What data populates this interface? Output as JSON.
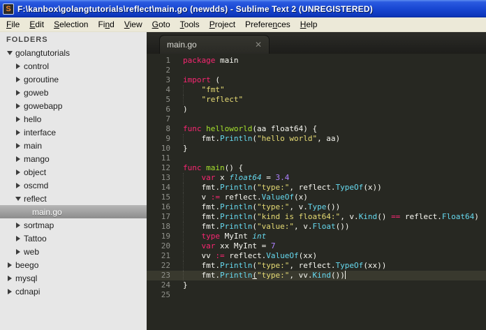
{
  "window": {
    "title": "F:\\kanbox\\golangtutorials\\reflect\\main.go (newdds) - Sublime Text 2 (UNREGISTERED)",
    "icon_letter": "S"
  },
  "menubar": {
    "items": [
      {
        "label": "File",
        "mnemonic_index": 0
      },
      {
        "label": "Edit",
        "mnemonic_index": 0
      },
      {
        "label": "Selection",
        "mnemonic_index": 0
      },
      {
        "label": "Find",
        "mnemonic_index": 2
      },
      {
        "label": "View",
        "mnemonic_index": 0
      },
      {
        "label": "Goto",
        "mnemonic_index": 0
      },
      {
        "label": "Tools",
        "mnemonic_index": 0
      },
      {
        "label": "Project",
        "mnemonic_index": 0
      },
      {
        "label": "Preferences",
        "mnemonic_index": 7
      },
      {
        "label": "Help",
        "mnemonic_index": 0
      }
    ]
  },
  "sidebar": {
    "header": "FOLDERS",
    "items": [
      {
        "label": "golangtutorials",
        "level": 0,
        "kind": "folder",
        "state": "expanded",
        "selected": false
      },
      {
        "label": "control",
        "level": 1,
        "kind": "folder",
        "state": "collapsed",
        "selected": false
      },
      {
        "label": "goroutine",
        "level": 1,
        "kind": "folder",
        "state": "collapsed",
        "selected": false
      },
      {
        "label": "goweb",
        "level": 1,
        "kind": "folder",
        "state": "collapsed",
        "selected": false
      },
      {
        "label": "gowebapp",
        "level": 1,
        "kind": "folder",
        "state": "collapsed",
        "selected": false
      },
      {
        "label": "hello",
        "level": 1,
        "kind": "folder",
        "state": "collapsed",
        "selected": false
      },
      {
        "label": "interface",
        "level": 1,
        "kind": "folder",
        "state": "collapsed",
        "selected": false
      },
      {
        "label": "main",
        "level": 1,
        "kind": "folder",
        "state": "collapsed",
        "selected": false
      },
      {
        "label": "mango",
        "level": 1,
        "kind": "folder",
        "state": "collapsed",
        "selected": false
      },
      {
        "label": "object",
        "level": 1,
        "kind": "folder",
        "state": "collapsed",
        "selected": false
      },
      {
        "label": "oscmd",
        "level": 1,
        "kind": "folder",
        "state": "collapsed",
        "selected": false
      },
      {
        "label": "reflect",
        "level": 1,
        "kind": "folder",
        "state": "expanded",
        "selected": false
      },
      {
        "label": "main.go",
        "level": 2,
        "kind": "file",
        "state": "none",
        "selected": true
      },
      {
        "label": "sortmap",
        "level": 1,
        "kind": "folder",
        "state": "collapsed",
        "selected": false
      },
      {
        "label": "Tattoo",
        "level": 1,
        "kind": "folder",
        "state": "collapsed",
        "selected": false
      },
      {
        "label": "web",
        "level": 1,
        "kind": "folder",
        "state": "collapsed",
        "selected": false
      },
      {
        "label": "beego",
        "level": 0,
        "kind": "folder",
        "state": "collapsed",
        "selected": false
      },
      {
        "label": "mysql",
        "level": 0,
        "kind": "folder",
        "state": "collapsed",
        "selected": false
      },
      {
        "label": "cdnapi",
        "level": 0,
        "kind": "folder",
        "state": "collapsed",
        "selected": false
      }
    ]
  },
  "editor": {
    "tab": {
      "label": "main.go",
      "close_glyph": "✕"
    },
    "language": "go",
    "cursor_line": 23,
    "colors": {
      "background": "#272822",
      "keyword": "#f92672",
      "plain": "#f8f8f2",
      "string": "#e6db74",
      "function_name": "#a6e22e",
      "type_italic": "#66d9ef",
      "builtin_call": "#66d9ef",
      "number": "#ae81ff",
      "gutter": "#8f908a",
      "line_highlight": "#39392e"
    },
    "lines": [
      {
        "n": 1,
        "tokens": [
          [
            "kw",
            "package"
          ],
          [
            "pl",
            " main"
          ]
        ]
      },
      {
        "n": 2,
        "tokens": []
      },
      {
        "n": 3,
        "tokens": [
          [
            "kw",
            "import"
          ],
          [
            "pl",
            " ("
          ]
        ]
      },
      {
        "n": 4,
        "tokens": [
          [
            "pl",
            "    "
          ],
          [
            "str",
            "\"fmt\""
          ]
        ]
      },
      {
        "n": 5,
        "tokens": [
          [
            "pl",
            "    "
          ],
          [
            "str",
            "\"reflect\""
          ]
        ]
      },
      {
        "n": 6,
        "tokens": [
          [
            "pl",
            ")"
          ]
        ]
      },
      {
        "n": 7,
        "tokens": []
      },
      {
        "n": 8,
        "tokens": [
          [
            "kw",
            "func"
          ],
          [
            "pl",
            " "
          ],
          [
            "fn",
            "helloworld"
          ],
          [
            "pl",
            "(aa float64) {"
          ]
        ]
      },
      {
        "n": 9,
        "tokens": [
          [
            "pl",
            "    fmt."
          ],
          [
            "call",
            "Println"
          ],
          [
            "pl",
            "("
          ],
          [
            "str",
            "\"hello world\""
          ],
          [
            "pl",
            ", aa)"
          ]
        ]
      },
      {
        "n": 10,
        "tokens": [
          [
            "pl",
            "}"
          ]
        ]
      },
      {
        "n": 11,
        "tokens": []
      },
      {
        "n": 12,
        "tokens": [
          [
            "kw",
            "func"
          ],
          [
            "pl",
            " "
          ],
          [
            "fn",
            "main"
          ],
          [
            "pl",
            "() {"
          ]
        ]
      },
      {
        "n": 13,
        "tokens": [
          [
            "pl",
            "    "
          ],
          [
            "kw",
            "var"
          ],
          [
            "pl",
            " x "
          ],
          [
            "ty",
            "float64"
          ],
          [
            "pl",
            " = "
          ],
          [
            "num",
            "3.4"
          ]
        ]
      },
      {
        "n": 14,
        "tokens": [
          [
            "pl",
            "    fmt."
          ],
          [
            "call",
            "Println"
          ],
          [
            "pl",
            "("
          ],
          [
            "str",
            "\"type:\""
          ],
          [
            "pl",
            ", reflect."
          ],
          [
            "call",
            "TypeOf"
          ],
          [
            "pl",
            "(x))"
          ]
        ]
      },
      {
        "n": 15,
        "tokens": [
          [
            "pl",
            "    v "
          ],
          [
            "kw",
            ":="
          ],
          [
            "pl",
            " reflect."
          ],
          [
            "call",
            "ValueOf"
          ],
          [
            "pl",
            "(x)"
          ]
        ]
      },
      {
        "n": 16,
        "tokens": [
          [
            "pl",
            "    fmt."
          ],
          [
            "call",
            "Println"
          ],
          [
            "pl",
            "("
          ],
          [
            "str",
            "\"type:\""
          ],
          [
            "pl",
            ", v."
          ],
          [
            "call",
            "Type"
          ],
          [
            "pl",
            "())"
          ]
        ]
      },
      {
        "n": 17,
        "tokens": [
          [
            "pl",
            "    fmt."
          ],
          [
            "call",
            "Println"
          ],
          [
            "pl",
            "("
          ],
          [
            "str",
            "\"kind is float64:\""
          ],
          [
            "pl",
            ", v."
          ],
          [
            "call",
            "Kind"
          ],
          [
            "pl",
            "() "
          ],
          [
            "kw",
            "=="
          ],
          [
            "pl",
            " reflect."
          ],
          [
            "call",
            "Float64"
          ],
          [
            "pl",
            ")"
          ]
        ]
      },
      {
        "n": 18,
        "tokens": [
          [
            "pl",
            "    fmt."
          ],
          [
            "call",
            "Println"
          ],
          [
            "pl",
            "("
          ],
          [
            "str",
            "\"value:\""
          ],
          [
            "pl",
            ", v."
          ],
          [
            "call",
            "Float"
          ],
          [
            "pl",
            "())"
          ]
        ]
      },
      {
        "n": 19,
        "tokens": [
          [
            "pl",
            "    "
          ],
          [
            "kw",
            "type"
          ],
          [
            "pl",
            " MyInt "
          ],
          [
            "ty",
            "int"
          ]
        ]
      },
      {
        "n": 20,
        "tokens": [
          [
            "pl",
            "    "
          ],
          [
            "kw",
            "var"
          ],
          [
            "pl",
            " xx MyInt = "
          ],
          [
            "num",
            "7"
          ]
        ]
      },
      {
        "n": 21,
        "tokens": [
          [
            "pl",
            "    vv "
          ],
          [
            "kw",
            ":="
          ],
          [
            "pl",
            " reflect."
          ],
          [
            "call",
            "ValueOf"
          ],
          [
            "pl",
            "(xx)"
          ]
        ]
      },
      {
        "n": 22,
        "tokens": [
          [
            "pl",
            "    fmt."
          ],
          [
            "call",
            "Println"
          ],
          [
            "pl",
            "("
          ],
          [
            "str",
            "\"type:\""
          ],
          [
            "pl",
            ", reflect."
          ],
          [
            "call",
            "TypeOf"
          ],
          [
            "pl",
            "(xx))"
          ]
        ]
      },
      {
        "n": 23,
        "tokens": [
          [
            "pl",
            "    fmt."
          ],
          [
            "call",
            "Println"
          ],
          [
            "plu",
            "("
          ],
          [
            "str",
            "\"type:\""
          ],
          [
            "pl",
            ", vv."
          ],
          [
            "call",
            "Kind"
          ],
          [
            "pl",
            "())"
          ]
        ]
      },
      {
        "n": 24,
        "tokens": [
          [
            "pl",
            "}"
          ]
        ]
      },
      {
        "n": 25,
        "tokens": []
      }
    ]
  }
}
